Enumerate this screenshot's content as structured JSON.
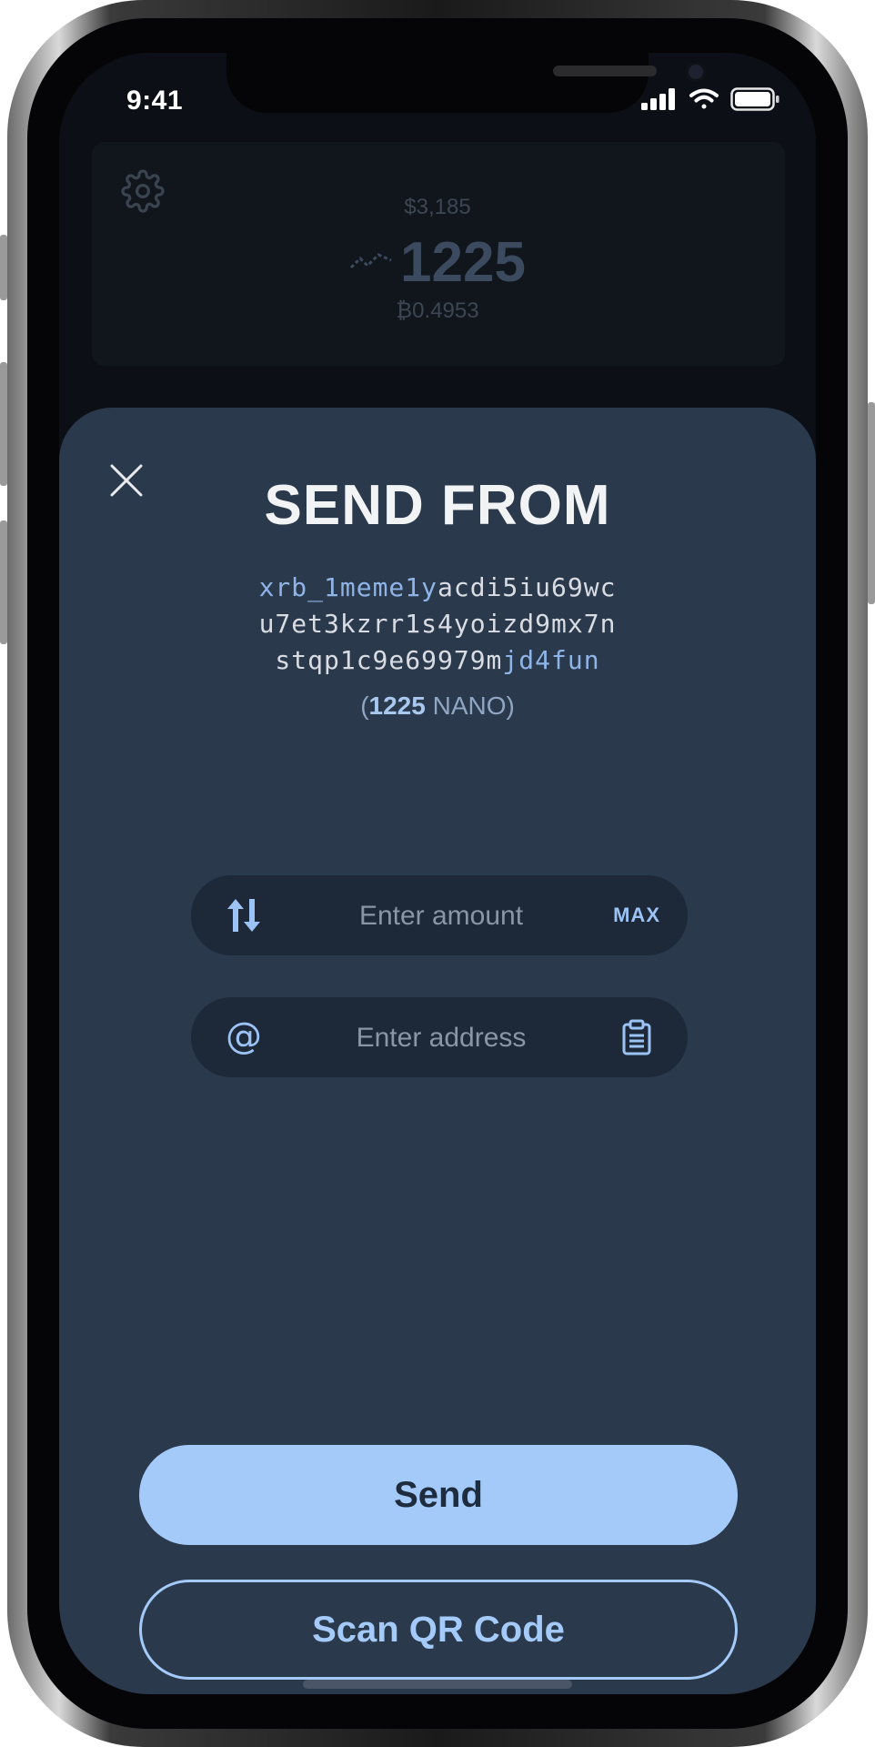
{
  "status_bar": {
    "time": "9:41"
  },
  "background_header": {
    "fiat_balance": "$3,185",
    "balance": "1225",
    "btc_balance": "₿0.4953"
  },
  "sheet": {
    "title": "SEND FROM",
    "address_lines": [
      {
        "hl_start": "xrb_1meme1y",
        "plain": "acdi5iu69wc",
        "hl_end": ""
      },
      {
        "hl_start": "",
        "plain": "u7et3kzrr1s4yoizd9mx7n",
        "hl_end": ""
      },
      {
        "hl_start": "",
        "plain": "stqp1c9e69979m",
        "hl_end": "jd4fun"
      }
    ],
    "balance_open": "(",
    "balance_amount": "1225",
    "balance_unit": " NANO)",
    "amount_field": {
      "placeholder": "Enter amount",
      "value": "",
      "max_label": "MAX"
    },
    "address_field": {
      "placeholder": "Enter address",
      "value": ""
    },
    "send_label": "Send",
    "scan_label": "Scan QR Code"
  },
  "icons": {
    "settings": "gear-icon",
    "close": "close-icon",
    "swap": "swap-arrows-icon",
    "at": "at-sign-icon",
    "paste": "clipboard-icon",
    "signal": "signal-icon",
    "wifi": "wifi-icon",
    "battery": "battery-icon",
    "nano_logo": "nano-logo-icon"
  },
  "colors": {
    "sheet_bg": "#2a394b",
    "field_bg": "#1d2838",
    "accent": "#a3caf9",
    "screen_bg": "#0c1016"
  }
}
